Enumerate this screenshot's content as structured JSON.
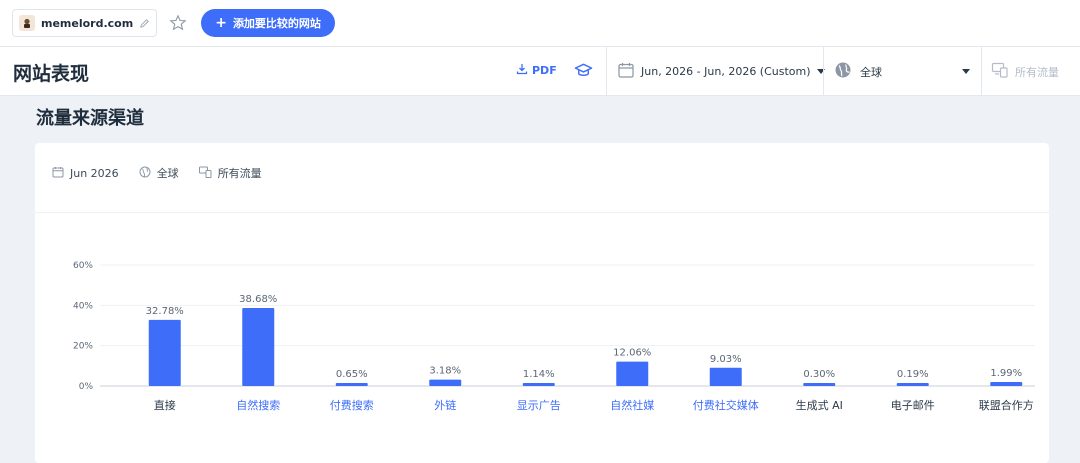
{
  "topbar": {
    "site_name": "memelord.com",
    "add_button_label": "添加要比较的网站"
  },
  "header": {
    "title": "网站表现",
    "pdf_label": "PDF",
    "date_range": "Jun, 2026 - Jun, 2026 (Custom)",
    "region": "全球",
    "traffic_type": "所有流量"
  },
  "section": {
    "title": "流量来源渠道"
  },
  "card": {
    "filter_date": "Jun 2026",
    "filter_region": "全球",
    "filter_traffic": "所有流量"
  },
  "colors": {
    "accent": "#3e6dfa",
    "bar": "#3e6dfa",
    "link_label": "#3e6dfa",
    "plain_label": "#2b3a4a"
  },
  "chart_data": {
    "type": "bar",
    "categories": [
      "直接",
      "自然搜索",
      "付费搜索",
      "外链",
      "显示广告",
      "自然社媒",
      "付费社交媒体",
      "生成式 AI",
      "电子邮件",
      "联盟合作方"
    ],
    "category_is_link": [
      false,
      true,
      true,
      true,
      true,
      true,
      true,
      false,
      false,
      false
    ],
    "values": [
      32.78,
      38.68,
      0.65,
      3.18,
      1.14,
      12.06,
      9.03,
      0.3,
      0.19,
      1.99
    ],
    "value_labels": [
      "32.78%",
      "38.68%",
      "0.65%",
      "3.18%",
      "1.14%",
      "12.06%",
      "9.03%",
      "0.30%",
      "0.19%",
      "1.99%"
    ],
    "y_ticks": [
      "0%",
      "20%",
      "40%",
      "60%"
    ],
    "ylim": [
      0,
      60
    ],
    "grid": true,
    "title": "",
    "xlabel": "",
    "ylabel": ""
  }
}
